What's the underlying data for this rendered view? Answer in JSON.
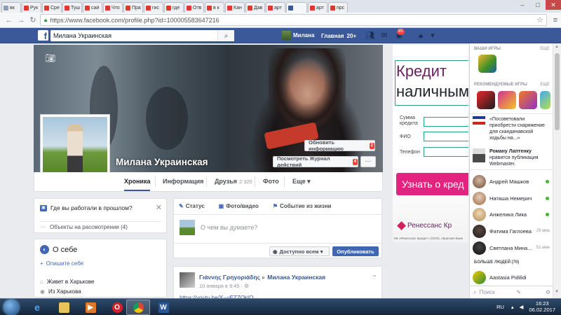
{
  "browser": {
    "tabs": [
      "вк",
      "Рук",
      "Сре",
      "Туш",
      "сай",
      "Что",
      "Пра",
      "гис",
      "где",
      "Отв",
      "в к",
      "Кан",
      "Дав",
      "арт",
      "",
      "арт",
      "прс"
    ],
    "url": "https://www.facebook.com/profile.php?id=100005583647216"
  },
  "fbbar": {
    "search_value": "Милана Украинская",
    "user_name": "Милана",
    "home_label": "Главная",
    "home_count": "20+",
    "notif_count": "85"
  },
  "profile": {
    "name": "Милана Украинская",
    "update_info_label": "Обновить информацию",
    "update_info_badge": "2",
    "activity_log_label": "Посмотреть Журнал действий",
    "activity_log_badge": "4",
    "more_label": "···"
  },
  "timeline_nav": {
    "items": [
      {
        "label": "Хроника"
      },
      {
        "label": "Информация"
      },
      {
        "label": "Друзья",
        "sub": "2 320"
      },
      {
        "label": "Фото"
      },
      {
        "label": "Еще ▾"
      }
    ]
  },
  "work_card": {
    "question": "Где вы работали в прошлом?",
    "pending": "Объекты на рассмотрении (4)"
  },
  "about": {
    "title": "О себе",
    "describe_label": "Опишите себя",
    "rows": [
      "Живет в Харькове",
      "Из Харькова"
    ]
  },
  "composer": {
    "tab_status": "Статус",
    "tab_photo": "Фото/видео",
    "tab_event": "Событие из жизни",
    "placeholder": "О чем вы думаете?",
    "audience": "Доступно всем ▾",
    "publish": "Опубликовать"
  },
  "post": {
    "author": "Γιάννης Γρηγοριάδης",
    "target": "Милана Украинская",
    "date": "10 января в 9:45 · ⚙",
    "link": "https://youtu.be/X--yEZZOkIQ"
  },
  "ad": {
    "headline1": "Кредит",
    "headline2": "наличным",
    "field1": "Сумма кредита",
    "field2": "ФИО",
    "field3": "Телефон",
    "cta": "Узнать о кред",
    "bank": "Ренессанс Кр",
    "fine": "КБ «Ренессанс Кредит» (ООО), лицензия Банк"
  },
  "chat": {
    "your_games": "ВАШИ ИГРЫ",
    "recommended_games": "РЕКОМЕНДУЕМЫЕ ИГРЫ",
    "more": "ЕЩЕ",
    "story1": "«Посоветовали приобрести снаряжение для скандинавской ходьбы на...»",
    "story2_name": "Роману Лаптенку",
    "story2_text": "нравится публикация Webmaster.",
    "friends": [
      {
        "name": "Андрей Машков",
        "status": "online"
      },
      {
        "name": "Наташа Немерич",
        "status": "online"
      },
      {
        "name": "Анжелика Лика",
        "status": "online"
      },
      {
        "name": "Фатима Гаглоева",
        "status": "29 мин"
      },
      {
        "name": "Светлана Мина...",
        "status": "51 мин"
      }
    ],
    "more_people": "БОЛЬШЕ ЛЮДЕЙ (70)",
    "extra_friend": "Aastasia Pidilidi",
    "search_placeholder": "Поиск"
  },
  "taskbar": {
    "lang": "RU",
    "time": "16:23",
    "date": "06.02.2017"
  },
  "colors": {
    "facebook_blue": "#3b5998",
    "accent": "#4267b2",
    "ad_pink": "#e4227f",
    "online_green": "#42b72a"
  }
}
